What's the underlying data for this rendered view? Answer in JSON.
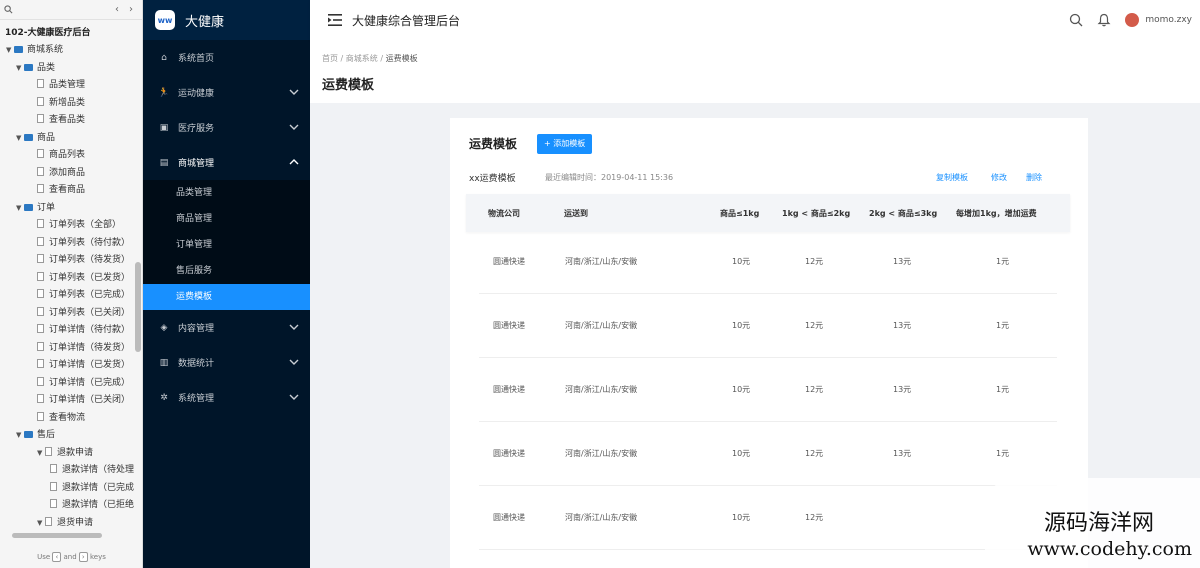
{
  "tree": {
    "search_icon": "search-icon",
    "title": "102-大健康医疗后台",
    "hint": {
      "pre": "Use",
      "and": "and",
      "post": "keys"
    },
    "items": [
      {
        "level": 0,
        "type": "folder",
        "open": true,
        "label": "商城系统"
      },
      {
        "level": 1,
        "type": "folder",
        "open": true,
        "label": "品类"
      },
      {
        "level": 2,
        "type": "page",
        "label": "品类管理"
      },
      {
        "level": 2,
        "type": "page",
        "label": "新增品类"
      },
      {
        "level": 2,
        "type": "page",
        "label": "查看品类"
      },
      {
        "level": 1,
        "type": "folder",
        "open": true,
        "label": "商品"
      },
      {
        "level": 2,
        "type": "page",
        "label": "商品列表"
      },
      {
        "level": 2,
        "type": "page",
        "label": "添加商品"
      },
      {
        "level": 2,
        "type": "page",
        "label": "查看商品"
      },
      {
        "level": 1,
        "type": "folder",
        "open": true,
        "label": "订单"
      },
      {
        "level": 2,
        "type": "page",
        "label": "订单列表（全部）"
      },
      {
        "level": 2,
        "type": "page",
        "label": "订单列表（待付款）"
      },
      {
        "level": 2,
        "type": "page",
        "label": "订单列表（待发货）"
      },
      {
        "level": 2,
        "type": "page",
        "label": "订单列表（已发货）"
      },
      {
        "level": 2,
        "type": "page",
        "label": "订单列表（已完成）"
      },
      {
        "level": 2,
        "type": "page",
        "label": "订单列表（已关闭）"
      },
      {
        "level": 2,
        "type": "page",
        "label": "订单详情（待付款）"
      },
      {
        "level": 2,
        "type": "page",
        "label": "订单详情（待发货）"
      },
      {
        "level": 2,
        "type": "page",
        "label": "订单详情（已发货）"
      },
      {
        "level": 2,
        "type": "page",
        "label": "订单详情（已完成）"
      },
      {
        "level": 2,
        "type": "page",
        "label": "订单详情（已关闭）"
      },
      {
        "level": 2,
        "type": "page",
        "label": "查看物流"
      },
      {
        "level": 1,
        "type": "folder",
        "open": true,
        "label": "售后"
      },
      {
        "level": 2,
        "type": "page",
        "open": true,
        "arrow": true,
        "label": "退款申请"
      },
      {
        "level": 3,
        "type": "page",
        "label": "退款详情（待处理"
      },
      {
        "level": 3,
        "type": "page",
        "label": "退款详情（已完成"
      },
      {
        "level": 3,
        "type": "page",
        "label": "退款详情（已拒绝"
      },
      {
        "level": 2,
        "type": "page",
        "open": true,
        "arrow": true,
        "label": "退货申请"
      }
    ]
  },
  "sidebar": {
    "logo_text": "大健康",
    "logo_mark": "ww",
    "menu": [
      {
        "icon": "⌂",
        "label": "系统首页",
        "chev": ""
      },
      {
        "icon": "🏃",
        "label": "运动健康",
        "chev": "down"
      },
      {
        "icon": "▣",
        "label": "医疗服务",
        "chev": "down"
      },
      {
        "icon": "▤",
        "label": "商城管理",
        "chev": "up"
      },
      {
        "icon": "◈",
        "label": "内容管理",
        "chev": "down"
      },
      {
        "icon": "▥",
        "label": "数据统计",
        "chev": "down"
      },
      {
        "icon": "✲",
        "label": "系统管理",
        "chev": "down"
      }
    ],
    "submenu": [
      "品类管理",
      "商品管理",
      "订单管理",
      "售后服务",
      "运费模板"
    ],
    "active_sub": 4
  },
  "header": {
    "title": "大健康综合管理后台",
    "username": "momo.zxy"
  },
  "breadcrumb": {
    "items": [
      "首页",
      "商城系统",
      "运费模板"
    ],
    "sep": "/"
  },
  "page_title": "运费模板",
  "card": {
    "title": "运费模板",
    "add_button": "+ 添加模板",
    "template": {
      "name": "xx运费模板",
      "meta": "最近编辑时间：2019-04-11 15:36",
      "actions": [
        "复制模板",
        "修改",
        "删除"
      ]
    },
    "columns": [
      "物流公司",
      "运送到",
      "商品≤1kg",
      "1kg < 商品≤2kg",
      "2kg < 商品≤3kg",
      "每增加1kg，增加运费"
    ],
    "rows": [
      [
        "圆通快递",
        "河南/浙江/山东/安徽",
        "10元",
        "12元",
        "13元",
        "1元"
      ],
      [
        "圆通快递",
        "河南/浙江/山东/安徽",
        "10元",
        "12元",
        "13元",
        "1元"
      ],
      [
        "圆通快递",
        "河南/浙江/山东/安徽",
        "10元",
        "12元",
        "13元",
        "1元"
      ],
      [
        "圆通快递",
        "河南/浙江/山东/安徽",
        "10元",
        "12元",
        "13元",
        "1元"
      ],
      [
        "圆通快递",
        "河南/浙江/山东/安徽",
        "10元",
        "12元",
        "",
        ""
      ]
    ]
  },
  "watermark": {
    "line1": "源码海洋网",
    "line2": "www.codehy.com"
  },
  "colors": {
    "sidebar_bg": "#001529",
    "accent": "#1890ff"
  }
}
